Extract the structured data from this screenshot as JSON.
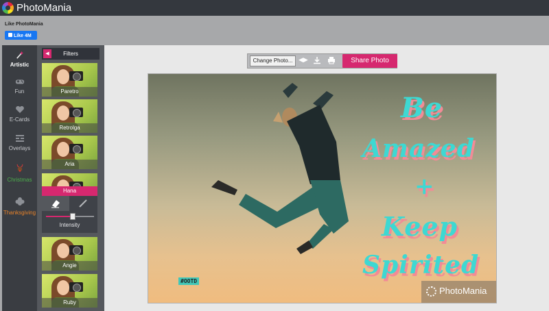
{
  "app": {
    "brand": "PhotoMania"
  },
  "like_bar": {
    "text": "Like PhotoMania",
    "fb_label": "Like 4M"
  },
  "categories": [
    {
      "label": "Artistic",
      "icon": "wand-icon",
      "color": "#ffffff"
    },
    {
      "label": "Fun",
      "icon": "gamepad-icon",
      "color": "#c9cbcf"
    },
    {
      "label": "E-Cards",
      "icon": "heart-icon",
      "color": "#c9cbcf"
    },
    {
      "label": "Overlays",
      "icon": "grid-icon",
      "color": "#c9cbcf"
    },
    {
      "label": "Christmas",
      "icon": "reindeer-icon",
      "color": "#4cae4c"
    },
    {
      "label": "Thanksgiving",
      "icon": "leaf-icon",
      "color": "#e8832a"
    }
  ],
  "panel": {
    "title": "Filters",
    "back_icon": "chevron-left-icon"
  },
  "filters": [
    {
      "label": "Paretro"
    },
    {
      "label": "Retrolga"
    },
    {
      "label": "Aria"
    },
    {
      "label": "Hana"
    },
    {
      "label": "Angie"
    },
    {
      "label": "Ruby"
    }
  ],
  "selected_filter": "Hana",
  "adjust": {
    "intensity_label": "Intensity",
    "intensity": 0.55,
    "tool_icons": [
      "eraser-icon",
      "brush-icon"
    ]
  },
  "toolbar": {
    "change_photo": "Change Photo...",
    "icons": [
      "compare-icon",
      "download-icon",
      "print-icon"
    ],
    "share": "Share Photo"
  },
  "photo": {
    "tag": "#OOTD",
    "slogan": [
      "Be",
      "Amazed",
      "+",
      "Keep",
      "Spirited"
    ],
    "watermark": "PhotoMania"
  },
  "colors": {
    "accent": "#d6286f",
    "topbar": "#34383e",
    "slogan": "#3ed8d2",
    "slogan_shadow": "#f28b96"
  }
}
